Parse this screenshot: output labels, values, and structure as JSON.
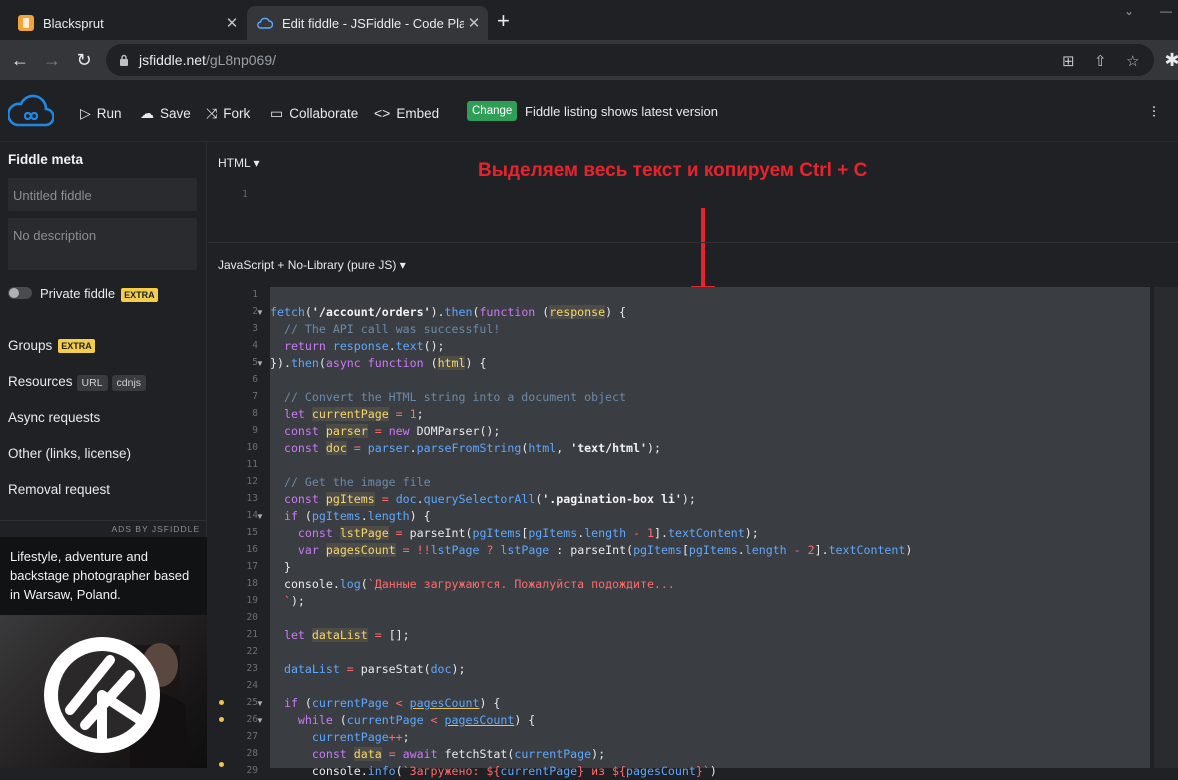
{
  "browser": {
    "tabs": [
      {
        "title": "Blacksprut",
        "active": false
      },
      {
        "title": "Edit fiddle - JSFiddle - Code Playground",
        "active": true
      }
    ],
    "url_domain": "jsfiddle.net",
    "url_path": "/gL8np069/"
  },
  "header": {
    "run": "Run",
    "save": "Save",
    "fork": "Fork",
    "collaborate": "Collaborate",
    "embed": "Embed",
    "change_badge": "Change",
    "change_text": "Fiddle listing shows latest version"
  },
  "sidebar": {
    "title": "Fiddle meta",
    "title_placeholder": "Untitled fiddle",
    "description_placeholder": "No description",
    "private_label": "Private fiddle",
    "extra": "EXTRA",
    "groups": "Groups",
    "resources": "Resources",
    "resources_chips": [
      "URL",
      "cdnjs"
    ],
    "async": "Async requests",
    "other": "Other (links, license)",
    "removal": "Removal request",
    "ads_by": "ADS BY JSFIDDLE",
    "ad_text": "Lifestyle, adventure and backstage photographer based in Warsaw, Poland."
  },
  "editor": {
    "html_label": "HTML ▾",
    "html_line": "1",
    "js_label": "JavaScript + No-Library (pure JS) ▾",
    "annotation": "Выделяем весь текст и копируем Ctrl + C"
  },
  "code_lines": [
    "1",
    "2",
    "3",
    "4",
    "5",
    "6",
    "7",
    "8",
    "9",
    "10",
    "11",
    "12",
    "13",
    "14",
    "15",
    "16",
    "17",
    "18",
    "19",
    "20",
    "21",
    "22",
    "23",
    "24",
    "25",
    "26",
    "27",
    "28",
    "29"
  ],
  "colors": {
    "accent_green": "#2f9e56",
    "annotation_red": "#e8232d",
    "logo_blue": "#1e88e5"
  }
}
